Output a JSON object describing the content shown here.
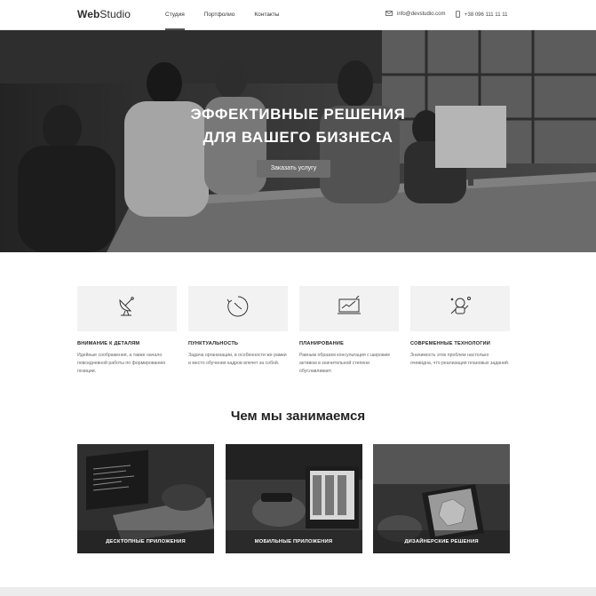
{
  "header": {
    "logo_bold": "Web",
    "logo_rest": "Studio",
    "nav": [
      {
        "label": "Студия",
        "active": true
      },
      {
        "label": "Портфолио",
        "active": false
      },
      {
        "label": "Контакты",
        "active": false
      }
    ],
    "email": "info@devstudio.com",
    "phone": "+38 096 111 11 11"
  },
  "hero": {
    "title_line1": "ЭФФЕКТИВНЫЕ РЕШЕНИЯ",
    "title_line2": "ДЛЯ ВАШЕГО БИЗНЕСА",
    "button": "Заказать услугу"
  },
  "features": [
    {
      "icon": "satellite-dish-icon",
      "title": "Внимание к деталям",
      "text": "Идейные соображения, а также начало повседневной работы по формированию позиции."
    },
    {
      "icon": "clock-icon",
      "title": "Пунктуальность",
      "text": "Задача организации, в особенности же рамки и место обучения кадров влечет за собой."
    },
    {
      "icon": "chart-monitor-icon",
      "title": "Планирование",
      "text": "Равным образом консультация с широким активом в значительной степени обуславливает."
    },
    {
      "icon": "astronaut-icon",
      "title": "Современные технологии",
      "text": "Значимость этих проблем настолько очевидна, что реализация плановых заданий."
    }
  ],
  "services_title": "Чем мы занимаемся",
  "services": [
    {
      "label": "Десктопные приложения"
    },
    {
      "label": "Мобильные приложения"
    },
    {
      "label": "Дизайнерские решения"
    }
  ],
  "colors": {
    "button_gray": "#6d6d6d",
    "feature_bg": "#f2f2f2",
    "text_dark": "#222222"
  }
}
